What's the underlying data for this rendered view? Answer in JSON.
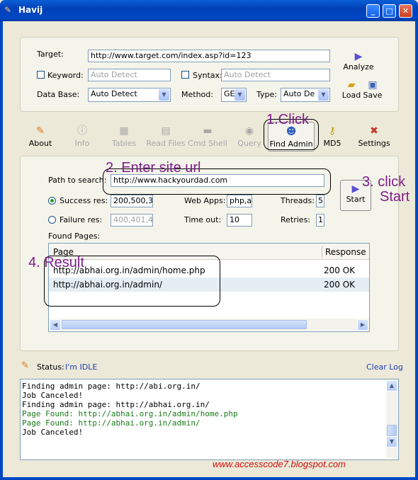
{
  "window": {
    "title": "Havij"
  },
  "form": {
    "target_label": "Target:",
    "target_value": "http://www.target.com/index.asp?id=123",
    "keyword_label": "Keyword:",
    "keyword_value": "Auto Detect",
    "syntax_label": "Syntax:",
    "syntax_value": "Auto Detect",
    "database_label": "Data Base:",
    "database_value": "Auto Detect",
    "method_label": "Method:",
    "method_value": "GE",
    "type_label": "Type:",
    "type_value": "Auto De",
    "analyze_label": "Analyze",
    "load_label": "Load",
    "save_label": "Save"
  },
  "toolbar": [
    {
      "label": "About",
      "icon": "carrot-icon",
      "enabled": true
    },
    {
      "label": "Info",
      "icon": "info-icon",
      "enabled": false
    },
    {
      "label": "Tables",
      "icon": "table-icon",
      "enabled": false
    },
    {
      "label": "Read Files",
      "icon": "file-icon",
      "enabled": false
    },
    {
      "label": "Cmd Shell",
      "icon": "console-icon",
      "enabled": false
    },
    {
      "label": "Query",
      "icon": "query-icon",
      "enabled": false
    },
    {
      "label": "Find Admin",
      "icon": "users-icon",
      "enabled": true
    },
    {
      "label": "MD5",
      "icon": "key-icon",
      "enabled": true
    },
    {
      "label": "Settings",
      "icon": "tools-icon",
      "enabled": true
    }
  ],
  "find_admin": {
    "path_label": "Path to search:",
    "path_value": "http://www.hackyourdad.com",
    "success_label": "Success res:",
    "success_value": "200,500,3",
    "failure_label": "Failure res:",
    "failure_value": "400,401,4",
    "webapps_label": "Web Apps:",
    "webapps_value": "php,a",
    "threads_label": "Threads:",
    "threads_value": "5",
    "timeout_label": "Time out:",
    "timeout_value": "10",
    "retries_label": "Retries:",
    "retries_value": "1",
    "start_label": "Start",
    "found_label": "Found Pages:",
    "columns": [
      "Page",
      "Response"
    ],
    "rows": [
      {
        "page": "http://abhai.org.in/admin/home.php",
        "response": "200 OK"
      },
      {
        "page": "http://abhai.org.in/admin/",
        "response": "200 OK"
      }
    ]
  },
  "annotations": {
    "step1": "1.Click",
    "step2": "2. Enter site url",
    "step3a": "3. click",
    "step3b": "Start",
    "step4": "4. Result"
  },
  "status": {
    "label": "Status:",
    "value": "I'm IDLE",
    "clear_log": "Clear Log"
  },
  "log": [
    {
      "text": "Finding admin page: http://abi.org.in/",
      "color": "#000000"
    },
    {
      "text": "Job Canceled!",
      "color": "#000000"
    },
    {
      "text": "Finding admin page: http://abhai.org.in/",
      "color": "#000000"
    },
    {
      "text": "Page Found: http://abhai.org.in/admin/home.php",
      "color": "#1a7a1a"
    },
    {
      "text": "Page Found: http://abhai.org.in/admin/",
      "color": "#1a7a1a"
    },
    {
      "text": "Job Canceled!",
      "color": "#000000"
    }
  ],
  "watermark": "www.accesscode7.blogspot.com",
  "colors": {
    "annotation": "#7d1d8b",
    "watermark": "#cc1010",
    "link": "#1c3fb0"
  }
}
